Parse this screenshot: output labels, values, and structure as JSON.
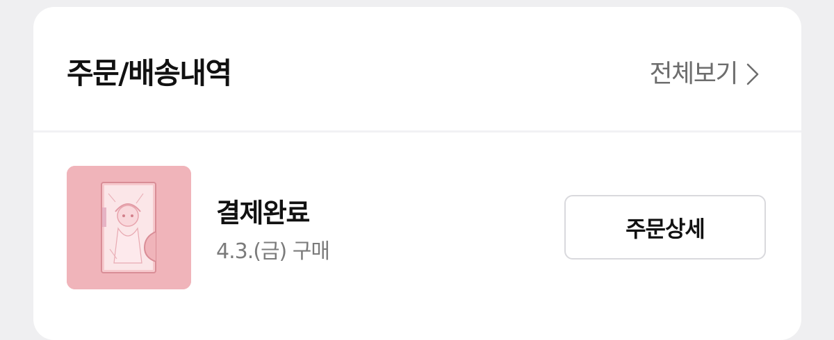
{
  "orders_section": {
    "title": "주문/배송내역",
    "view_all_label": "전체보기"
  },
  "order": {
    "status": "결제완료",
    "date_text": "4.3.(금) 구매",
    "detail_button_label": "주문상세",
    "thumbnail": "product-photo"
  },
  "colors": {
    "page_background": "#efeff1",
    "card_background": "#ffffff",
    "thumbnail_pink": "#f0b4ba",
    "muted_text": "#7b7b7b",
    "button_border": "#d9d9dd"
  }
}
